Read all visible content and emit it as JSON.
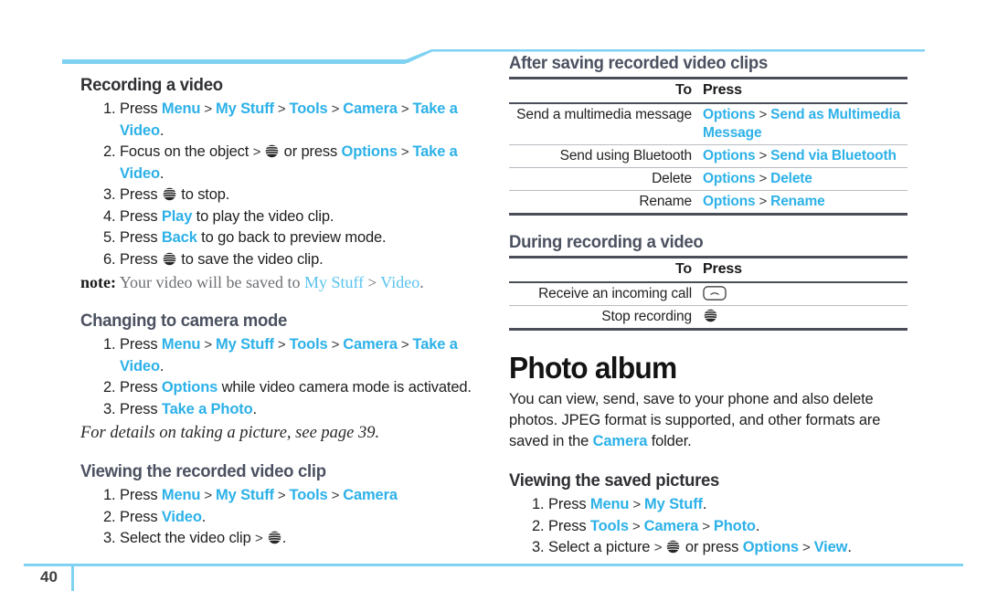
{
  "page": {
    "number": "40",
    "accent_blue": "#2db1e8",
    "deco_blue": "#7fd2f2",
    "heading_gray": "#4b5160"
  },
  "icons": {
    "att_globe": "att-globe-icon",
    "call_key": "call-key-icon"
  },
  "left_column": {
    "sections": [
      {
        "heading": "Recording a video",
        "steps": [
          [
            {
              "t": "Press ",
              "s": "plain"
            },
            {
              "t": "Menu",
              "s": "blue"
            },
            {
              "t": " > ",
              "s": "gt"
            },
            {
              "t": "My Stuff",
              "s": "blue"
            },
            {
              "t": " > ",
              "s": "gt"
            },
            {
              "t": "Tools",
              "s": "blue"
            },
            {
              "t": " > ",
              "s": "gt"
            },
            {
              "t": "Camera",
              "s": "blue"
            },
            {
              "t": " > ",
              "s": "gt"
            },
            {
              "t": "Take a Video",
              "s": "blue"
            },
            {
              "t": ".",
              "s": "plain"
            }
          ],
          [
            {
              "t": "Focus on the object ",
              "s": "plain"
            },
            {
              "t": "> ",
              "s": "gt"
            },
            {
              "t": "",
              "s": "globe"
            },
            {
              "t": " or press ",
              "s": "plain"
            },
            {
              "t": "Options",
              "s": "blue"
            },
            {
              "t": " > ",
              "s": "gt"
            },
            {
              "t": "Take a Video",
              "s": "blue"
            },
            {
              "t": ".",
              "s": "plain"
            }
          ],
          [
            {
              "t": "Press ",
              "s": "plain"
            },
            {
              "t": "",
              "s": "globe"
            },
            {
              "t": " to stop.",
              "s": "plain"
            }
          ],
          [
            {
              "t": "Press ",
              "s": "plain"
            },
            {
              "t": "Play",
              "s": "blue"
            },
            {
              "t": " to play the video clip.",
              "s": "plain"
            }
          ],
          [
            {
              "t": "Press ",
              "s": "plain"
            },
            {
              "t": "Back",
              "s": "blue"
            },
            {
              "t": " to go back to preview mode.",
              "s": "plain"
            }
          ],
          [
            {
              "t": "Press ",
              "s": "plain"
            },
            {
              "t": "",
              "s": "globe"
            },
            {
              "t": " to save the video clip.",
              "s": "plain"
            }
          ]
        ],
        "note": {
          "label": "note:",
          "text_before": " Your video will be saved to ",
          "link1": "My Stuff",
          "sep": " > ",
          "link2": "Video",
          "text_after": "."
        }
      },
      {
        "heading": "Changing to camera mode",
        "steps": [
          [
            {
              "t": "Press ",
              "s": "plain"
            },
            {
              "t": "Menu",
              "s": "blue"
            },
            {
              "t": " > ",
              "s": "gt"
            },
            {
              "t": "My Stuff",
              "s": "blue"
            },
            {
              "t": " > ",
              "s": "gt"
            },
            {
              "t": "Tools",
              "s": "blue"
            },
            {
              "t": " > ",
              "s": "gt"
            },
            {
              "t": "Camera",
              "s": "blue"
            },
            {
              "t": " > ",
              "s": "gt"
            },
            {
              "t": "Take a Video",
              "s": "blue"
            },
            {
              "t": ".",
              "s": "plain"
            }
          ],
          [
            {
              "t": "Press ",
              "s": "plain"
            },
            {
              "t": "Options",
              "s": "blue"
            },
            {
              "t": " while video camera mode is activated.",
              "s": "plain"
            }
          ],
          [
            {
              "t": "Press ",
              "s": "plain"
            },
            {
              "t": "Take a Photo",
              "s": "blue"
            },
            {
              "t": ".",
              "s": "plain"
            }
          ]
        ],
        "italic_ref": "For details on taking a picture, see page 39."
      },
      {
        "heading": "Viewing the recorded video clip",
        "steps": [
          [
            {
              "t": "Press ",
              "s": "plain"
            },
            {
              "t": "Menu",
              "s": "blue"
            },
            {
              "t": " > ",
              "s": "gt"
            },
            {
              "t": "My Stuff",
              "s": "blue"
            },
            {
              "t": " > ",
              "s": "gt"
            },
            {
              "t": "Tools",
              "s": "blue"
            },
            {
              "t": " > ",
              "s": "gt"
            },
            {
              "t": "Camera",
              "s": "blue"
            }
          ],
          [
            {
              "t": "Press ",
              "s": "plain"
            },
            {
              "t": "Video",
              "s": "blue"
            },
            {
              "t": ".",
              "s": "plain"
            }
          ],
          [
            {
              "t": "Select the video clip ",
              "s": "plain"
            },
            {
              "t": "> ",
              "s": "gt"
            },
            {
              "t": "",
              "s": "globe"
            },
            {
              "t": ".",
              "s": "plain"
            }
          ]
        ]
      }
    ]
  },
  "right_column": {
    "table1": {
      "heading": "After saving recorded video clips",
      "columns": [
        "To",
        "Press"
      ],
      "rows": [
        {
          "to": "Send a multimedia message",
          "press": [
            {
              "t": "Options",
              "s": "blue"
            },
            {
              "t": " > ",
              "s": "gt"
            },
            {
              "t": "Send as Multimedia Message",
              "s": "blue"
            }
          ]
        },
        {
          "to": "Send using Bluetooth",
          "press": [
            {
              "t": "Options",
              "s": "blue"
            },
            {
              "t": " > ",
              "s": "gt"
            },
            {
              "t": "Send via Bluetooth",
              "s": "blue"
            }
          ]
        },
        {
          "to": "Delete",
          "press": [
            {
              "t": "Options",
              "s": "blue"
            },
            {
              "t": " > ",
              "s": "gt"
            },
            {
              "t": "Delete",
              "s": "blue"
            }
          ]
        },
        {
          "to": "Rename",
          "press": [
            {
              "t": "Options",
              "s": "blue"
            },
            {
              "t": " > ",
              "s": "gt"
            },
            {
              "t": "Rename",
              "s": "blue"
            }
          ]
        }
      ]
    },
    "table2": {
      "heading": "During recording a video",
      "columns": [
        "To",
        "Press"
      ],
      "rows": [
        {
          "to": "Receive an incoming call",
          "press": [
            {
              "t": "",
              "s": "callkey"
            }
          ]
        },
        {
          "to": "Stop recording",
          "press": [
            {
              "t": "",
              "s": "globe"
            }
          ]
        }
      ]
    },
    "photo_album": {
      "heading": "Photo album",
      "body": [
        {
          "t": "You can view, send, save to your phone and also delete photos. JPEG format is supported, and other formats are saved in the ",
          "s": "plain"
        },
        {
          "t": "Camera",
          "s": "blue"
        },
        {
          "t": " folder.",
          "s": "plain"
        }
      ]
    },
    "viewing_pictures": {
      "heading": "Viewing the saved pictures",
      "steps": [
        [
          {
            "t": "Press ",
            "s": "plain"
          },
          {
            "t": "Menu",
            "s": "blue"
          },
          {
            "t": " > ",
            "s": "gt"
          },
          {
            "t": "My Stuff",
            "s": "blue"
          },
          {
            "t": ".",
            "s": "plain"
          }
        ],
        [
          {
            "t": "Press ",
            "s": "plain"
          },
          {
            "t": "Tools",
            "s": "blue"
          },
          {
            "t": " > ",
            "s": "gt"
          },
          {
            "t": "Camera",
            "s": "blue"
          },
          {
            "t": " > ",
            "s": "gt"
          },
          {
            "t": "Photo",
            "s": "blue"
          },
          {
            "t": ".",
            "s": "plain"
          }
        ],
        [
          {
            "t": "Select a picture ",
            "s": "plain"
          },
          {
            "t": "> ",
            "s": "gt"
          },
          {
            "t": "",
            "s": "globe"
          },
          {
            "t": " or press ",
            "s": "plain"
          },
          {
            "t": "Options",
            "s": "blue"
          },
          {
            "t": " > ",
            "s": "gt"
          },
          {
            "t": "View",
            "s": "blue"
          },
          {
            "t": ".",
            "s": "plain"
          }
        ]
      ]
    }
  }
}
